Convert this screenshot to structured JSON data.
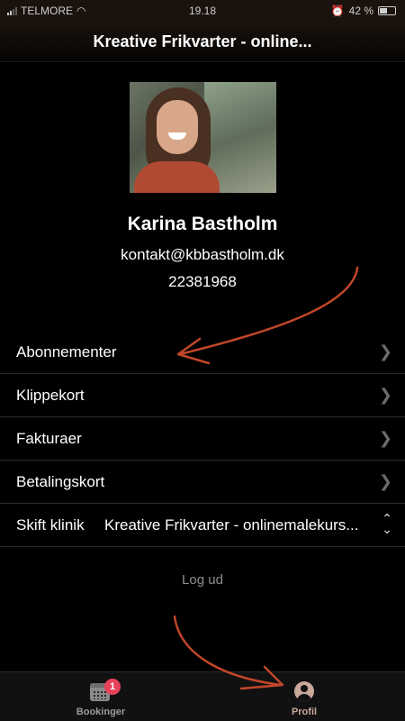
{
  "status_bar": {
    "carrier": "TELMORE",
    "time": "19.18",
    "battery": "42 %"
  },
  "nav": {
    "title": "Kreative Frikvarter - online..."
  },
  "profile": {
    "name": "Karina Bastholm",
    "email": "kontakt@kbbastholm.dk",
    "phone": "22381968"
  },
  "menu": {
    "items": [
      {
        "label": "Abonnementer"
      },
      {
        "label": "Klippekort"
      },
      {
        "label": "Fakturaer"
      },
      {
        "label": "Betalingskort"
      }
    ],
    "clinic": {
      "label": "Skift klinik",
      "value": "Kreative Frikvarter - onlinemalekurs..."
    }
  },
  "logout_label": "Log ud",
  "tabs": [
    {
      "label": "Bookinger",
      "badge": "1"
    },
    {
      "label": "Profil"
    }
  ],
  "colors": {
    "accent": "#c9a79a",
    "badge": "#e8425a",
    "annotation": "#c2462a"
  }
}
